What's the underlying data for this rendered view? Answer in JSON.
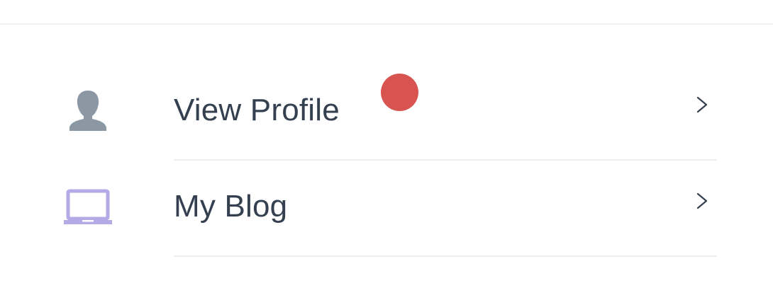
{
  "menu": {
    "items": [
      {
        "label": "View Profile",
        "icon": "user-silhouette-icon",
        "icon_color": "#8b98a4",
        "trailing_icon": "chevron-right-icon"
      },
      {
        "label": "My Blog",
        "icon": "laptop-icon",
        "icon_color": "#b3abe6",
        "trailing_icon": "chevron-right-icon"
      }
    ]
  },
  "colors": {
    "text": "#34404f",
    "divider": "#eceef1",
    "touch_indicator": "#d85450"
  }
}
